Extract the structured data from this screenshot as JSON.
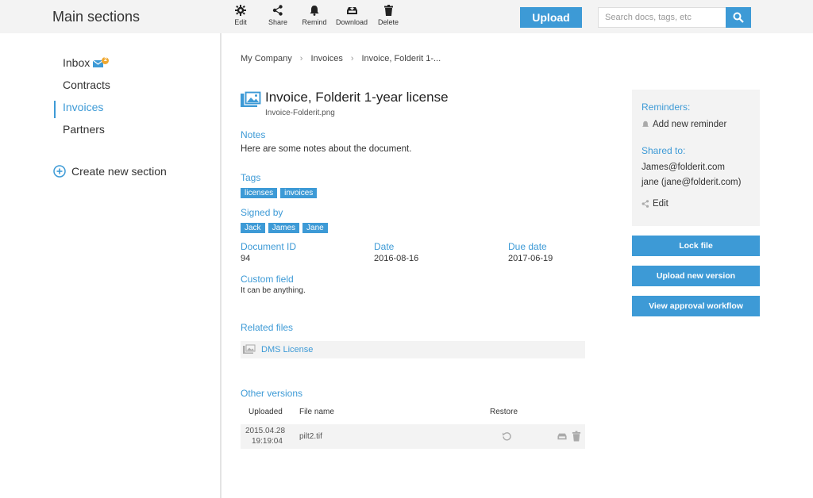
{
  "header": {
    "title": "Main sections",
    "tools": [
      {
        "label": "Edit",
        "icon": "gear-icon"
      },
      {
        "label": "Share",
        "icon": "share-icon"
      },
      {
        "label": "Remind",
        "icon": "bell-icon"
      },
      {
        "label": "Download",
        "icon": "download-icon"
      },
      {
        "label": "Delete",
        "icon": "trash-icon"
      }
    ],
    "upload_label": "Upload",
    "search_placeholder": "Search docs, tags, etc"
  },
  "sidebar": {
    "items": [
      {
        "label": "Inbox",
        "badge": "2"
      },
      {
        "label": "Contracts"
      },
      {
        "label": "Invoices",
        "active": true
      },
      {
        "label": "Partners"
      }
    ],
    "create_label": "Create new section"
  },
  "breadcrumb": [
    "My Company",
    "Invoices",
    "Invoice, Folderit 1-..."
  ],
  "document": {
    "title": "Invoice, Folderit 1-year license",
    "filename": "Invoice-Folderit.png",
    "notes_label": "Notes",
    "notes": "Here are some notes about the document.",
    "tags_label": "Tags",
    "tags": [
      "licenses",
      "invoices"
    ],
    "signed_label": "Signed by",
    "signed_by": [
      "Jack",
      "James",
      "Jane"
    ],
    "doc_id_label": "Document ID",
    "doc_id": "94",
    "date_label": "Date",
    "date": "2016-08-16",
    "due_label": "Due date",
    "due": "2017-06-19",
    "custom_label": "Custom field",
    "custom": "It can be anything.",
    "related_label": "Related files",
    "related": [
      "DMS License"
    ],
    "versions_label": "Other versions",
    "versions_columns": [
      "Uploaded",
      "File name",
      "Restore"
    ],
    "versions": [
      {
        "uploaded_date": "2015.04.28",
        "uploaded_time": "19:19:04",
        "file": "pilt2.tif"
      }
    ]
  },
  "right_panel": {
    "reminders_label": "Reminders:",
    "add_reminder": "Add new reminder",
    "shared_label": "Shared to:",
    "shared": [
      "James@folderit.com",
      "jane (jane@folderit.com)"
    ],
    "edit_label": "Edit",
    "buttons": [
      "Lock file",
      "Upload new version",
      "View approval workflow"
    ]
  },
  "colors": {
    "accent": "#3d9ad6",
    "badge": "#f0a830",
    "panel": "#f3f3f3"
  }
}
